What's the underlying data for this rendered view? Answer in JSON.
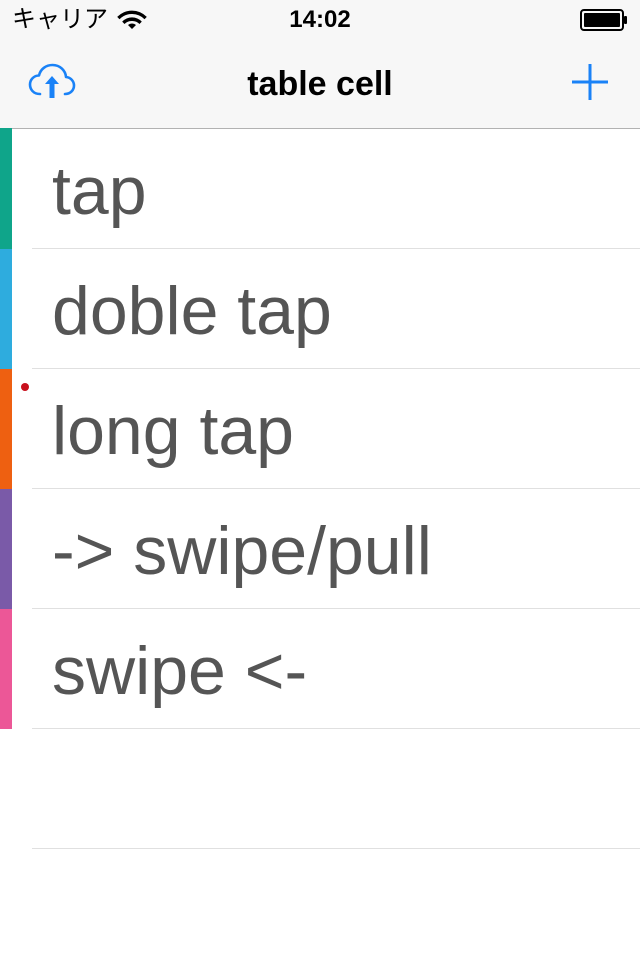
{
  "status_bar": {
    "carrier": "キャリア",
    "time": "14:02"
  },
  "nav": {
    "title": "table cell",
    "left_icon": "cloud-upload-icon",
    "right_icon": "plus-icon",
    "accent_color": "#1a82f7"
  },
  "table": {
    "rows": [
      {
        "label": "tap",
        "color": "#0fa58a"
      },
      {
        "label": "doble tap",
        "color": "#2eacde"
      },
      {
        "label": "long tap",
        "color": "#ee6011"
      },
      {
        "label": "-> swipe/pull",
        "color": "#7a5aa8"
      },
      {
        "label": "swipe <-",
        "color": "#ec5797"
      },
      {
        "label": "",
        "color": ""
      }
    ]
  },
  "indicator_color": "#c8101c"
}
